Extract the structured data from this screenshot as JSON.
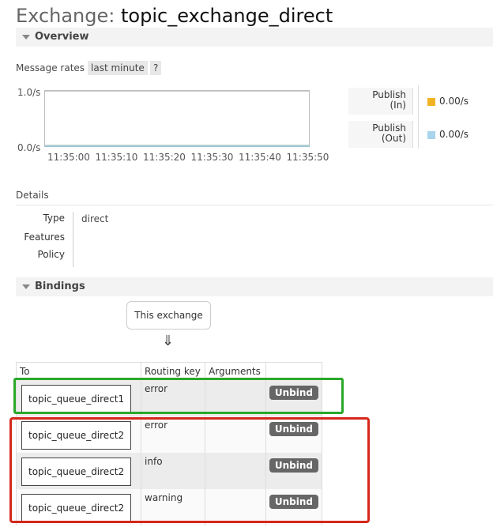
{
  "header": {
    "title_prefix": "Exchange:",
    "title_name": "topic_exchange_direct"
  },
  "overview": {
    "section_label": "Overview"
  },
  "rates": {
    "label": "Message rates",
    "range_selector": "last minute",
    "help": "?",
    "y_max_label": "1.0/s",
    "y_min_label": "0.0/s",
    "x_ticks": [
      "11:35:00",
      "11:35:10",
      "11:35:20",
      "11:35:30",
      "11:35:40",
      "11:35:50"
    ],
    "legend": [
      {
        "label_line1": "Publish",
        "label_line2": "(In)",
        "value": "0.00/s",
        "color": "#f0b323"
      },
      {
        "label_line1": "Publish",
        "label_line2": "(Out)",
        "value": "0.00/s",
        "color": "#a8d4ec"
      }
    ]
  },
  "details": {
    "heading": "Details",
    "type_label": "Type",
    "type_value": "direct",
    "features_label": "Features",
    "features_value": "",
    "policy_label": "Policy",
    "policy_value": ""
  },
  "bindings": {
    "section_label": "Bindings",
    "source_box": "This exchange",
    "arrow": "⇓",
    "columns": [
      "To",
      "Routing key",
      "Arguments",
      ""
    ],
    "unbind_label": "Unbind",
    "rows": [
      {
        "to": "topic_queue_direct1",
        "routing_key": "error",
        "arguments": ""
      },
      {
        "to": "topic_queue_direct2",
        "routing_key": "error",
        "arguments": ""
      },
      {
        "to": "topic_queue_direct2",
        "routing_key": "info",
        "arguments": ""
      },
      {
        "to": "topic_queue_direct2",
        "routing_key": "warning",
        "arguments": ""
      }
    ]
  },
  "chart_data": {
    "type": "line",
    "x": [
      "11:35:00",
      "11:35:10",
      "11:35:20",
      "11:35:30",
      "11:35:40",
      "11:35:50"
    ],
    "series": [
      {
        "name": "Publish (In)",
        "values": [
          0,
          0,
          0,
          0,
          0,
          0
        ]
      },
      {
        "name": "Publish (Out)",
        "values": [
          0,
          0,
          0,
          0,
          0,
          0
        ]
      }
    ],
    "ylim": [
      0,
      1
    ],
    "y_tick_labels": [
      "0.0/s",
      "1.0/s"
    ]
  }
}
